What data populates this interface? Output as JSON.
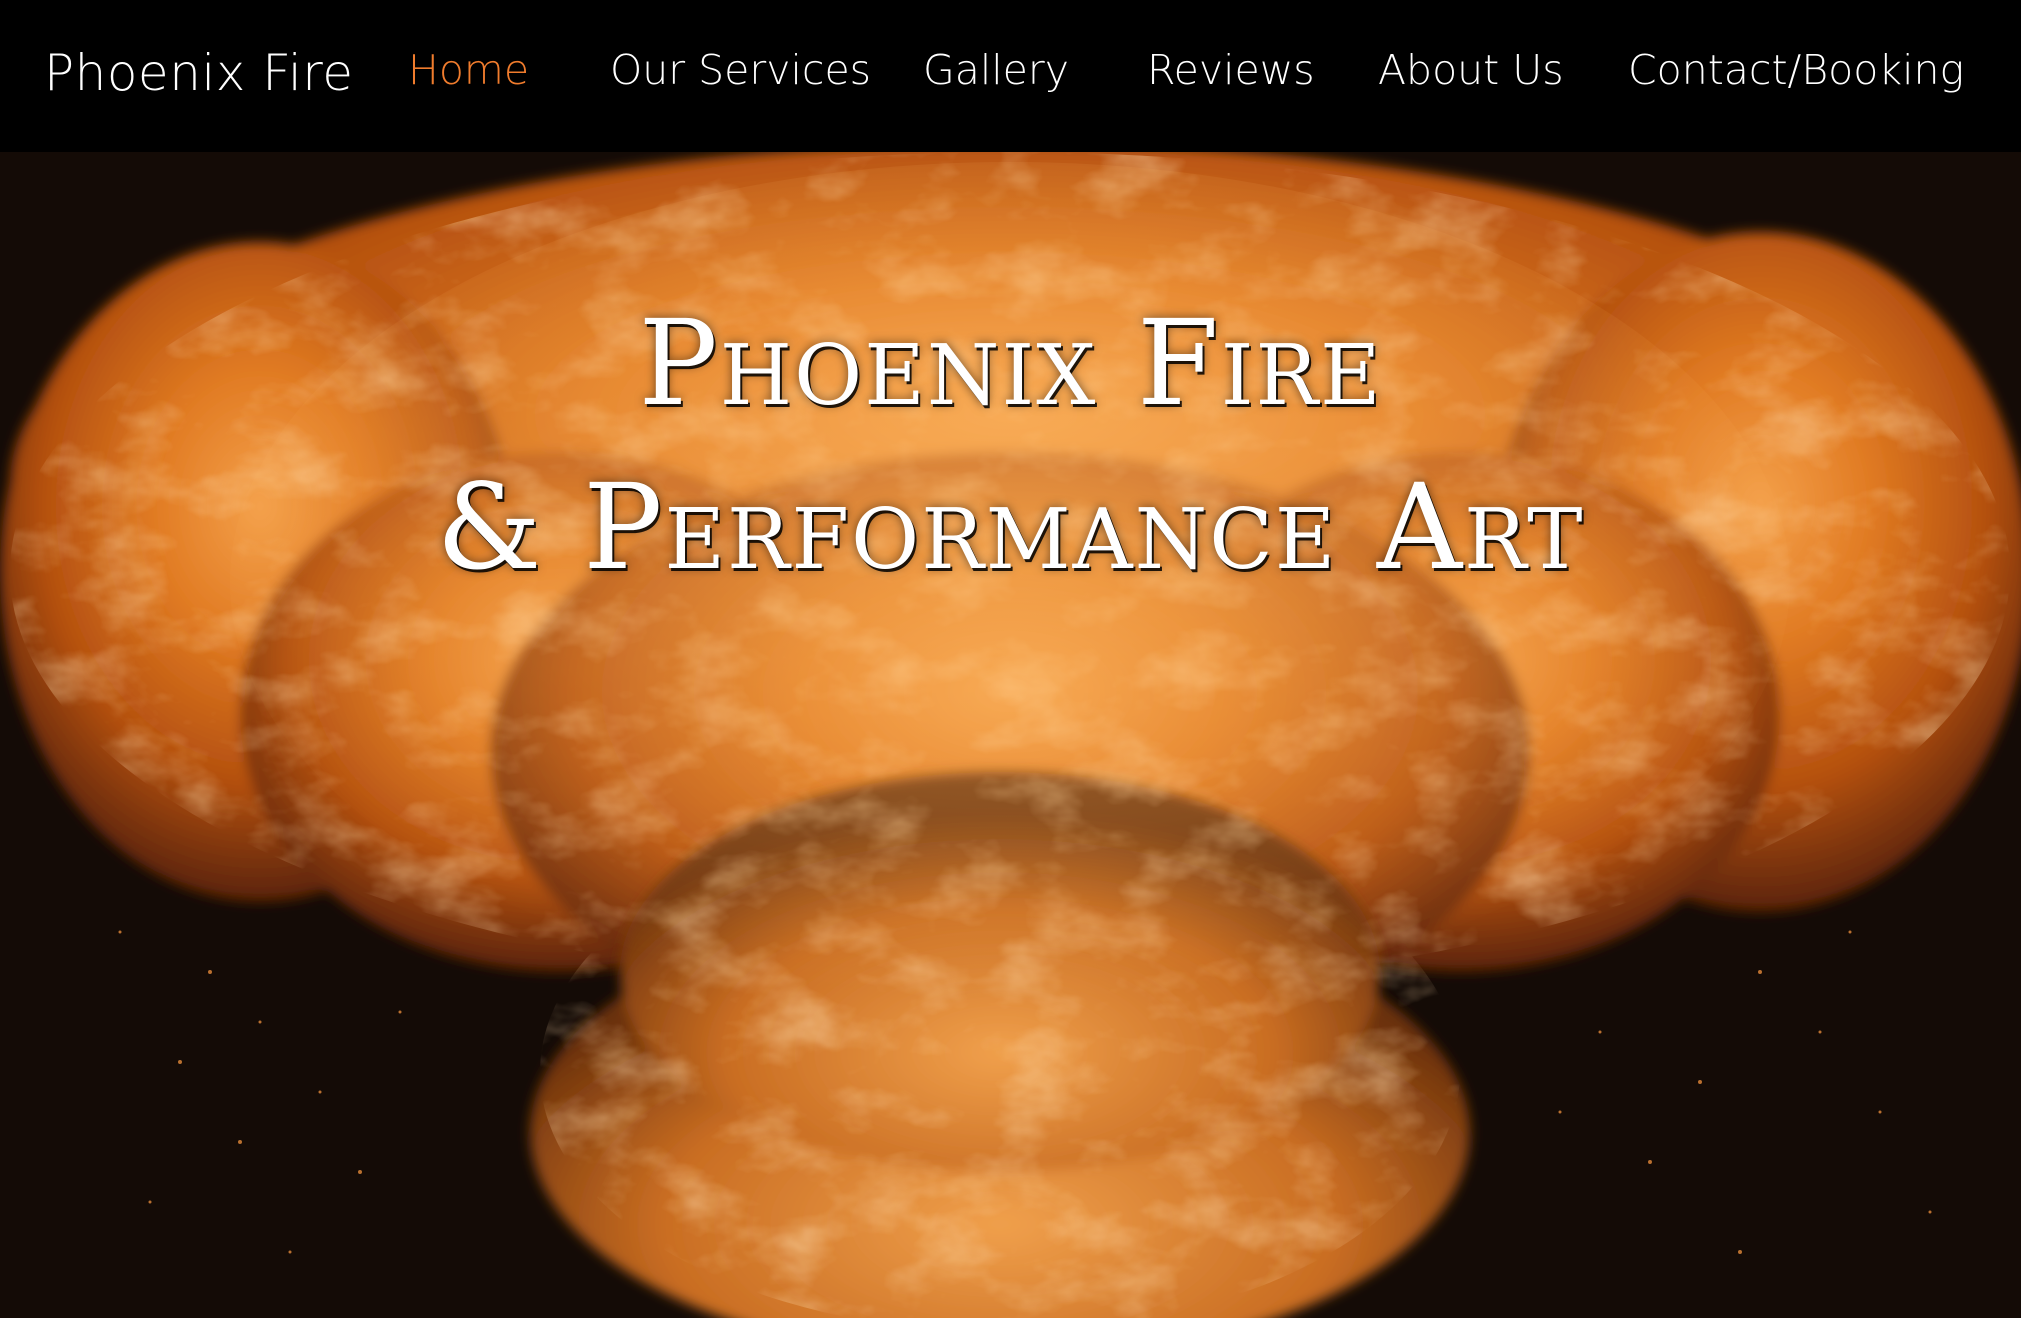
{
  "header": {
    "brand": "Phoenix Fire",
    "nav": [
      {
        "label": "Home",
        "active": true
      },
      {
        "label": "Our Services",
        "active": false
      },
      {
        "label": "Gallery",
        "active": false
      },
      {
        "label": "Reviews",
        "active": false
      },
      {
        "label": "About Us",
        "active": false
      },
      {
        "label": "Contact/Booking",
        "active": false
      }
    ]
  },
  "hero": {
    "title_line1": "Phoenix Fire",
    "title_line2": "& Performance Art",
    "image": "fire-explosion-image"
  },
  "colors": {
    "header_bg": "#000000",
    "nav_text": "#ffffff",
    "nav_active": "#f07c2d",
    "fire_orange": "#e8771f",
    "background_dark": "#140b06"
  }
}
